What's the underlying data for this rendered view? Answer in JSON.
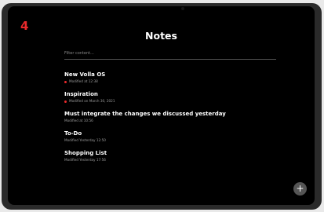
{
  "app": {
    "badge": "4",
    "title": "Notes"
  },
  "search": {
    "placeholder": "Filter content..."
  },
  "notes": [
    {
      "title": "New Volla OS",
      "meta": "Modified at 12:38",
      "flagged": true
    },
    {
      "title": "Inspiration",
      "meta": "Modified on March 30, 2021",
      "flagged": true
    },
    {
      "title": "Must integrate the changes we discussed yesterday",
      "meta": "Modified at 10:56",
      "flagged": false
    },
    {
      "title": "To-Do",
      "meta": "Modified Yesterday 12:50",
      "flagged": false
    },
    {
      "title": "Shopping List",
      "meta": "Modified Yesterday 17:56",
      "flagged": false
    }
  ],
  "fab": {
    "label": "+",
    "icon": "plus-icon"
  },
  "colors": {
    "accent": "#e8292b",
    "background": "#000000"
  }
}
